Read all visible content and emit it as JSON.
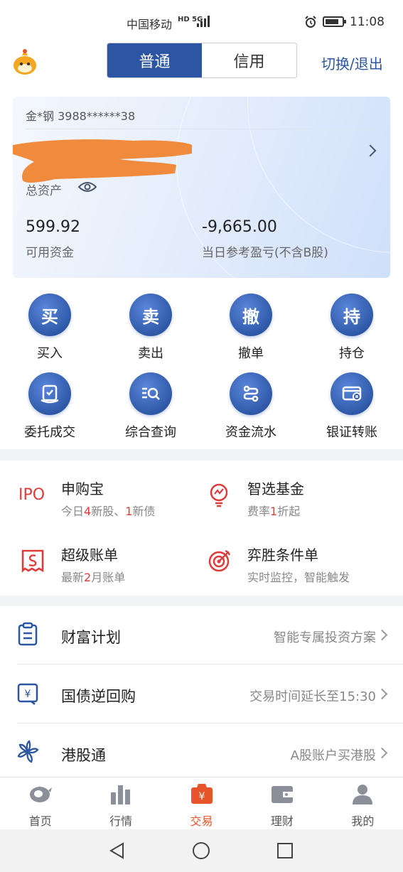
{
  "status_bar": {
    "carrier": "中国移动",
    "net": "HD 5G",
    "time": "11:08"
  },
  "top": {
    "tabs": [
      {
        "label": "普通"
      },
      {
        "label": "信用"
      }
    ],
    "switch_label": "切换/退出"
  },
  "account": {
    "id": "金*钢  3988******38",
    "total_label": "总资产",
    "available_value": "599.92",
    "available_label": "可用资金",
    "pnl_value": "-9,665.00",
    "pnl_label": "当日参考盈亏(不含B股)"
  },
  "actions": [
    {
      "glyph": "买",
      "label": "买入"
    },
    {
      "glyph": "卖",
      "label": "卖出"
    },
    {
      "glyph": "撤",
      "label": "撤单"
    },
    {
      "glyph": "持",
      "label": "持仓"
    },
    {
      "label": "委托成交",
      "icon": "order-icon"
    },
    {
      "label": "综合查询",
      "icon": "search-list-icon"
    },
    {
      "label": "资金流水",
      "icon": "flow-icon"
    },
    {
      "label": "银证转账",
      "icon": "card-transfer-icon"
    }
  ],
  "features": [
    {
      "title": "申购宝",
      "icon_text": "IPO",
      "sub": [
        "今日",
        "4",
        "新股、",
        "1",
        "新债"
      ]
    },
    {
      "title": "智选基金",
      "icon": "fund-icon",
      "sub": [
        "费率",
        "1",
        "折起"
      ]
    },
    {
      "title": "超级账单",
      "icon": "bill-icon",
      "sub": [
        "最新",
        "2",
        "月账单"
      ]
    },
    {
      "title": "弈胜条件单",
      "icon": "target-icon",
      "sub": [
        "实时监控，智能触发"
      ]
    }
  ],
  "list": [
    {
      "title": "财富计划",
      "right": "智能专属投资方案",
      "icon": "clipboard-icon"
    },
    {
      "title": "国债逆回购",
      "right": "交易时间延长至15:30",
      "icon": "bond-icon"
    },
    {
      "title": "港股通",
      "right": "A股账户买港股",
      "icon": "bauhinia-icon"
    }
  ],
  "tabbar": [
    {
      "label": "首页"
    },
    {
      "label": "行情"
    },
    {
      "label": "交易"
    },
    {
      "label": "理财"
    },
    {
      "label": "我的"
    }
  ],
  "colors": {
    "primary": "#2c56a4",
    "accent": "#e8542a",
    "red": "#e03b3b"
  }
}
